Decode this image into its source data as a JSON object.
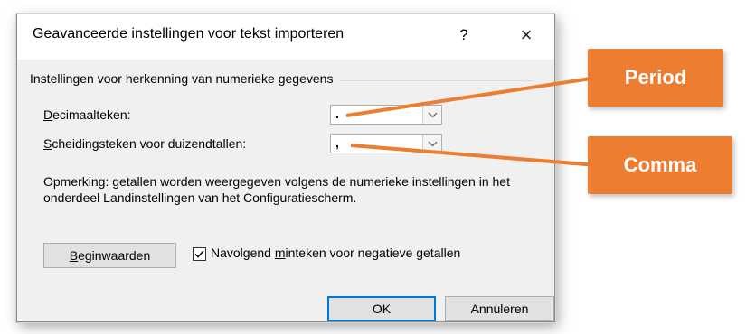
{
  "dialog": {
    "title": "Geavanceerde instellingen voor tekst importeren",
    "help": "?",
    "close": "×"
  },
  "group": {
    "label": "Instellingen voor herkenning van numerieke gegevens"
  },
  "decimal": {
    "label_ul": "D",
    "label_rest": "ecimaalteken:",
    "value": "."
  },
  "thousands": {
    "label_ul": "S",
    "label_rest": "cheidingsteken voor duizendtallen:",
    "value": ","
  },
  "note": "Opmerking: getallen worden weergegeven volgens de numerieke instellingen in het onderdeel Landinstellingen van het Configuratiescherm.",
  "reset_button": {
    "ul": "B",
    "rest": "eginwaarden"
  },
  "checkbox": {
    "checked": true,
    "label_a": "Navolgend ",
    "label_ul": "m",
    "label_b": "inteken voor negatieve getallen"
  },
  "ok_label": "OK",
  "cancel_label": "Annuleren",
  "callouts": {
    "period": "Period",
    "comma": "Comma"
  },
  "colors": {
    "callout": "#ed7d31",
    "accent": "#0078d7"
  }
}
